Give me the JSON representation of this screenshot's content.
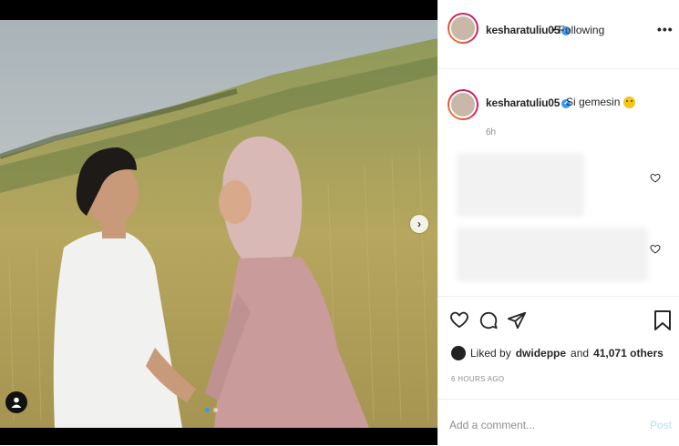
{
  "post": {
    "username": "kesharatuliu05",
    "verified_glyph": "✓",
    "separator": "•",
    "follow_status": "Following",
    "more_label": "•••"
  },
  "caption": {
    "username": "kesharatuliu05",
    "text": "Si gemesin",
    "emoji": "grinning-face-emoji",
    "time": "6h"
  },
  "carousel": {
    "next_glyph": "›",
    "slide_count": 2,
    "current_slide": 1
  },
  "likes": {
    "prefix": "Liked by",
    "user": "dwideppe",
    "middle": "and",
    "count": "41,071 others"
  },
  "timestamp": "6 HOURS AGO",
  "comment": {
    "placeholder": "Add a comment...",
    "post_label": "Post"
  },
  "colors": {
    "accent": "#3897f0",
    "post_disabled": "#b2dffc",
    "muted": "#8e8e8e"
  },
  "icons": [
    "heart-icon",
    "comment-icon",
    "share-icon",
    "bookmark-icon",
    "user-tag-icon",
    "chevron-right-icon",
    "verified-icon",
    "more-icon"
  ]
}
